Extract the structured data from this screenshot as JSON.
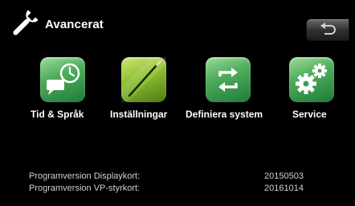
{
  "header": {
    "title": "Avancerat",
    "icon": "wrench-icon",
    "back_icon": "back-arrow-icon"
  },
  "menu": {
    "items": [
      {
        "label": "Tid & Språk",
        "icon": "clock-speech-icon"
      },
      {
        "label": "Inställningar",
        "icon": "pencil-icon"
      },
      {
        "label": "Definiera system",
        "icon": "cycle-arrows-icon"
      },
      {
        "label": "Service",
        "icon": "gears-icon"
      }
    ]
  },
  "versions": [
    {
      "label": "Programversion Displaykort:",
      "value": "20150503"
    },
    {
      "label": "Programversion VP-styrkort:",
      "value": "20161014"
    }
  ],
  "colors": {
    "background": "#000000",
    "tile_green": "#3f9e52",
    "tile_olive": "#8cbf2e",
    "text": "#ffffff",
    "version_text": "#cfcfcf"
  }
}
